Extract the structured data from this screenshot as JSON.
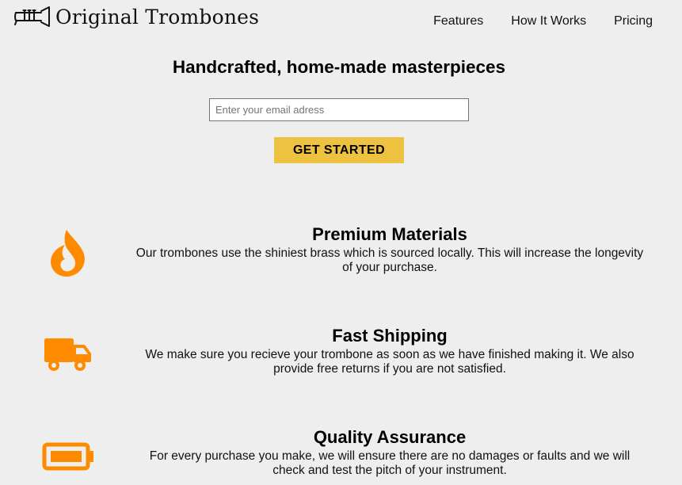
{
  "brand": {
    "name": "Original Trombones",
    "logo_icon": "trombone-icon"
  },
  "nav": {
    "items": [
      "Features",
      "How It Works",
      "Pricing"
    ]
  },
  "hero": {
    "title": "Handcrafted, home-made masterpieces",
    "email_placeholder": "Enter your email adress",
    "cta_label": "GET STARTED"
  },
  "features": [
    {
      "icon": "fire-icon",
      "title": "Premium Materials",
      "description": "Our trombones use the shiniest brass which is sourced locally. This will increase the longevity of your purchase."
    },
    {
      "icon": "truck-icon",
      "title": "Fast Shipping",
      "description": "We make sure you recieve your trombone as soon as we have finished making it. We also provide free returns if you are not satisfied."
    },
    {
      "icon": "battery-icon",
      "title": "Quality Assurance",
      "description": "For every purchase you make, we will ensure there are no damages or faults and we will check and test the pitch of your instrument."
    }
  ],
  "colors": {
    "background": "#eeeeee",
    "accent": "#edc240",
    "icon": "#fe8a00"
  }
}
